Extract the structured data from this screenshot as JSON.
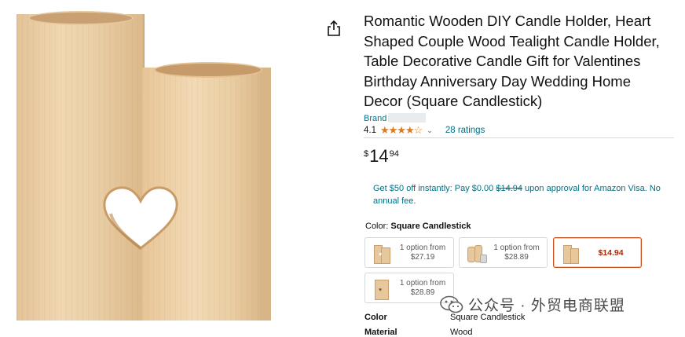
{
  "product": {
    "title_lines": [
      "Romantic Wooden DIY Candle Holder, Heart",
      "Shaped Couple Wood Tealight Candle Holder,",
      "Table Decorative Candle Gift for Valentines",
      "Birthday Anniversary Day Wedding Home",
      "Decor (Square Candlestick)"
    ],
    "brand_label": "Brand",
    "rating": "4.1",
    "stars": "★★★★☆",
    "ratings_text": "28 ratings",
    "price": {
      "symbol": "$",
      "whole": "14",
      "fraction": "94"
    },
    "offer": {
      "prefix": "Get $50 off instantly: Pay $0.00 ",
      "strike": "$14.94",
      "suffix": " upon approval for Amazon Visa. No annual fee."
    },
    "color": {
      "label": "Color:",
      "selected": "Square Candlestick"
    },
    "options": [
      {
        "line1": "1 option from",
        "line2": "$27.19"
      },
      {
        "line1": "1 option from",
        "line2": "$28.89"
      },
      {
        "price": "$14.94"
      },
      {
        "line1": "1 option from",
        "line2": "$28.89"
      }
    ],
    "specs": [
      {
        "key": "Color",
        "value": "Square Candlestick"
      },
      {
        "key": "Material",
        "value": "Wood"
      }
    ]
  },
  "watermark": {
    "text": "公众号 · 外贸电商联盟"
  },
  "colors": {
    "link": "#007185",
    "star": "#de7921",
    "price_red": "#b12704",
    "selected_border": "#c7511f"
  },
  "icons": [
    "share-icon",
    "chevron-down-icon",
    "wechat-icon"
  ]
}
